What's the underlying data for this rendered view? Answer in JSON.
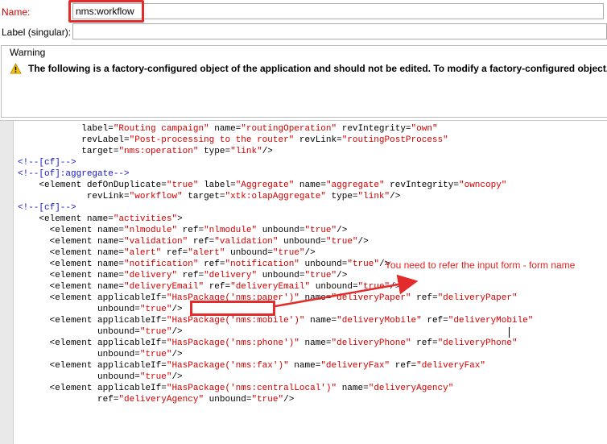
{
  "form": {
    "name_label": "Name:",
    "name_value": "nms:workflow",
    "singular_label": "Label (singular):",
    "singular_value": ""
  },
  "warning": {
    "title": "Warning",
    "message": "The following is a factory-configured object of the application and should not be edited. To modify a factory-configured object, you"
  },
  "annotation": {
    "text": "You need to refer the input form - form name",
    "color": "#e32b2b"
  },
  "code_lines": [
    "            label=\"Routing campaign\" name=\"routingOperation\" revIntegrity=\"own\"",
    "            revLabel=\"Post-processing to the router\" revLink=\"routingPostProcess\"",
    "            target=\"nms:operation\" type=\"link\"/>",
    "<!--[cf]-->",
    "<!--[of]:aggregate-->",
    "    <element defOnDuplicate=\"true\" label=\"Aggregate\" name=\"aggregate\" revIntegrity=\"owncopy\"",
    "             revLink=\"workflow\" target=\"xtk:olapAggregate\" type=\"link\"/>",
    "<!--[cf]-->",
    "",
    "    <element name=\"activities\">",
    "",
    "      <element name=\"nlmodule\" ref=\"nlmodule\" unbound=\"true\"/>",
    "",
    "      <element name=\"validation\" ref=\"validation\" unbound=\"true\"/>",
    "      <element name=\"alert\" ref=\"alert\" unbound=\"true\"/>",
    "      <element name=\"notification\" ref=\"notification\" unbound=\"true\"/>",
    "      <element name=\"delivery\" ref=\"delivery\" unbound=\"true\"/>",
    "      <element name=\"deliveryEmail\" ref=\"deliveryEmail\" unbound=\"true\"/>",
    "      <element applicableIf=\"HasPackage('nms:paper')\" name=\"deliveryPaper\" ref=\"deliveryPaper\"",
    "               unbound=\"true\"/>",
    "      <element applicableIf=\"HasPackage('nms:mobile')\" name=\"deliveryMobile\" ref=\"deliveryMobile\"",
    "               unbound=\"true\"/>",
    "      <element applicableIf=\"HasPackage('nms:phone')\" name=\"deliveryPhone\" ref=\"deliveryPhone\"",
    "               unbound=\"true\"/>",
    "      <element applicableIf=\"HasPackage('nms:fax')\" name=\"deliveryFax\" ref=\"deliveryFax\"",
    "               unbound=\"true\"/>",
    "      <element applicableIf=\"HasPackage('nms:centralLocal')\" name=\"deliveryAgency\"",
    "               ref=\"deliveryAgency\" unbound=\"true\"/>"
  ]
}
